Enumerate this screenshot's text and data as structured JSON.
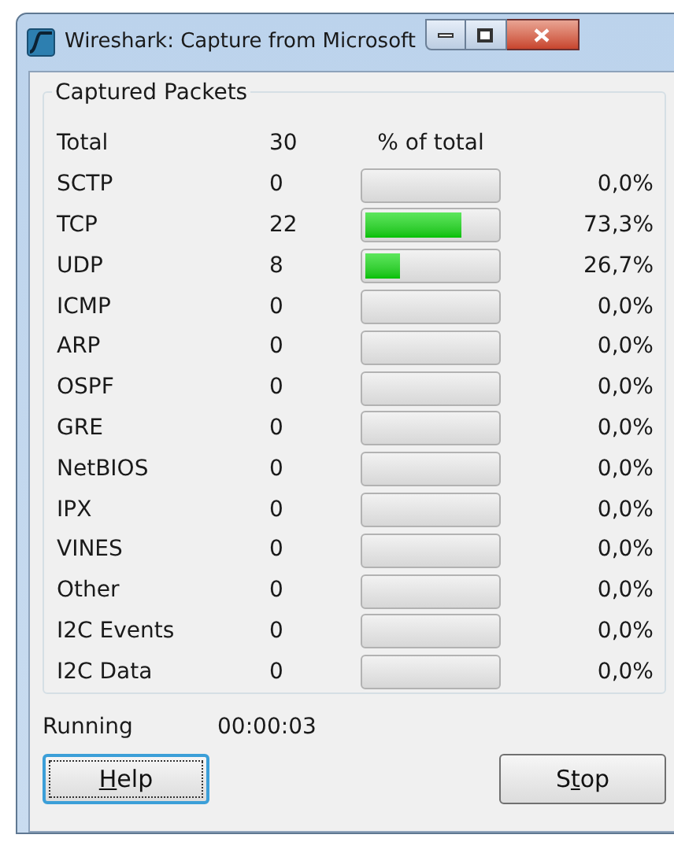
{
  "window": {
    "title": "Wireshark: Capture from Microsoft"
  },
  "group": {
    "title": "Captured Packets"
  },
  "header": {
    "name": "Total",
    "count": "30",
    "percent_label": "% of total"
  },
  "rows": [
    {
      "name": "SCTP",
      "count": "0",
      "percent": "0,0%"
    },
    {
      "name": "TCP",
      "count": "22",
      "level": 0.733,
      "percent": "73,3%"
    },
    {
      "name": "UDP",
      "count": "8",
      "level": 0.267,
      "percent": "26,7%"
    },
    {
      "name": "ICMP",
      "count": "0",
      "percent": "0,0%"
    },
    {
      "name": "ARP",
      "count": "0",
      "percent": "0,0%"
    },
    {
      "name": "OSPF",
      "count": "0",
      "percent": "0,0%"
    },
    {
      "name": "GRE",
      "count": "0",
      "percent": "0,0%"
    },
    {
      "name": "NetBIOS",
      "count": "0",
      "percent": "0,0%"
    },
    {
      "name": "IPX",
      "count": "0",
      "percent": "0,0%"
    },
    {
      "name": "VINES",
      "count": "0",
      "percent": "0,0%"
    },
    {
      "name": "Other",
      "count": "0",
      "percent": "0,0%"
    },
    {
      "name": "I2C Events",
      "count": "0",
      "percent": "0,0%"
    },
    {
      "name": "I2C Data",
      "count": "0",
      "percent": "0,0%"
    }
  ],
  "status": {
    "label": "Running",
    "elapsed": "00:00:03"
  },
  "buttons": [
    {
      "key": "H",
      "after": "elp",
      "focused": true
    },
    {
      "before": "S",
      "key": "t",
      "after": "op",
      "focused": false
    }
  ]
}
